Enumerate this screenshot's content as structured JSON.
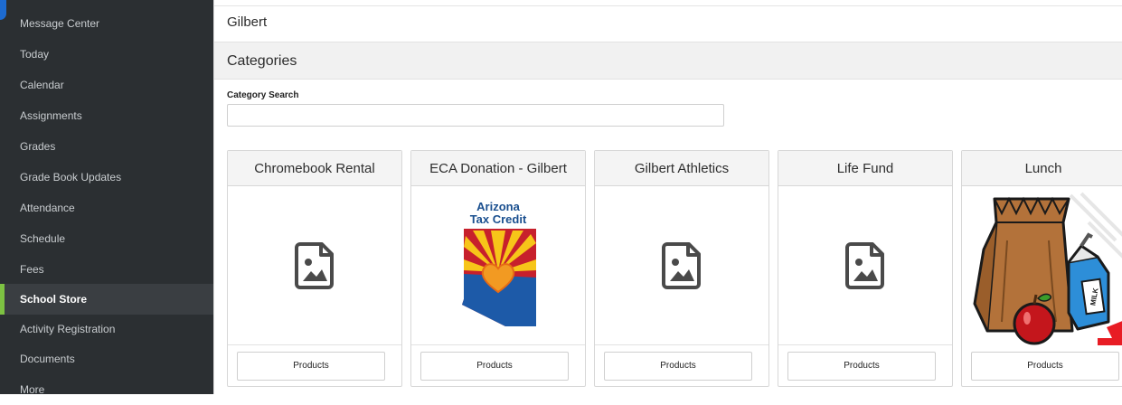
{
  "sidebar": {
    "items": [
      {
        "label": "Message Center"
      },
      {
        "label": "Today"
      },
      {
        "label": "Calendar"
      },
      {
        "label": "Assignments"
      },
      {
        "label": "Grades"
      },
      {
        "label": "Grade Book Updates"
      },
      {
        "label": "Attendance"
      },
      {
        "label": "Schedule"
      },
      {
        "label": "Fees"
      },
      {
        "label": "School Store"
      },
      {
        "label": "Activity Registration"
      },
      {
        "label": "Documents"
      },
      {
        "label": "More"
      }
    ],
    "active_item": "School Store",
    "accent_color": "#7dc242"
  },
  "header": {
    "school_name": "Gilbert"
  },
  "categories": {
    "title": "Categories",
    "search_label": "Category Search",
    "search_value": "",
    "cards": [
      {
        "title": "Chromebook Rental",
        "image": "placeholder-image-icon",
        "button_label": "Products"
      },
      {
        "title": "ECA Donation - Gilbert",
        "image": "arizona-tax-credit-logo",
        "logo_text_line1": "Arizona",
        "logo_text_line2": "Tax Credit",
        "button_label": "Products"
      },
      {
        "title": "Gilbert Athletics",
        "image": "placeholder-image-icon",
        "button_label": "Products"
      },
      {
        "title": "Life Fund",
        "image": "placeholder-image-icon",
        "button_label": "Products"
      },
      {
        "title": "Lunch",
        "image": "lunch-bag-illustration",
        "milk_label": "MILK",
        "button_label": "Products"
      }
    ]
  }
}
